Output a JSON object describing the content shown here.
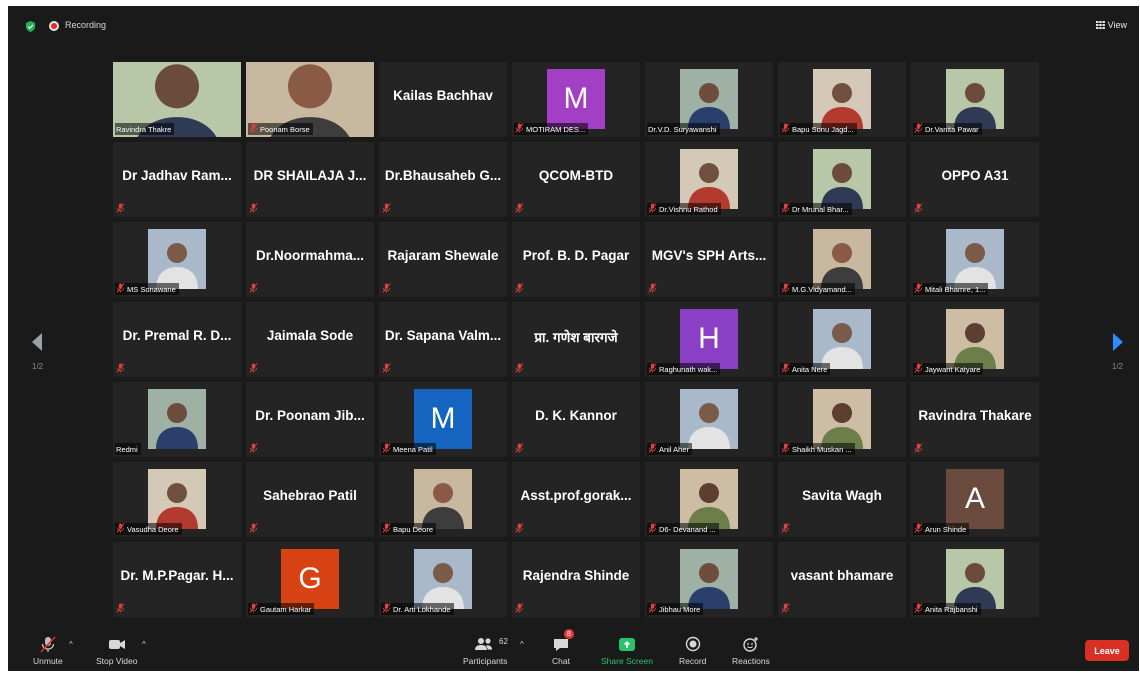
{
  "app": {
    "recording_label": "Recording",
    "view_label": "View"
  },
  "pager": {
    "left_page": "1/2",
    "right_page": "1/2"
  },
  "tiles": [
    {
      "label": "Ravindra Thakre",
      "kind": "video",
      "muted": false,
      "active": true
    },
    {
      "label": "Poonam Borse",
      "kind": "video",
      "muted": true
    },
    {
      "name": "Kailas Bachhav",
      "kind": "name",
      "muted": false
    },
    {
      "label": "MOTIRAM DES...",
      "kind": "avatar",
      "letter": "M",
      "color": "#a23fc4",
      "muted": true
    },
    {
      "label": "Dr.V.D. Suryawanshi",
      "kind": "photo",
      "muted": false
    },
    {
      "label": "Bapu Sonu Jagd...",
      "kind": "photo",
      "muted": true
    },
    {
      "label": "Dr.Vanita Pawar",
      "kind": "photo",
      "muted": true
    },
    {
      "name": "Dr Jadhav  Ram...",
      "kind": "name",
      "muted": true
    },
    {
      "name": "DR SHAILAJA J...",
      "kind": "name",
      "muted": true
    },
    {
      "name": "Dr.Bhausaheb  G...",
      "kind": "name",
      "muted": true
    },
    {
      "name": "QCOM-BTD",
      "kind": "name",
      "muted": true
    },
    {
      "label": "Dr.Vishnu Rathod",
      "kind": "photo",
      "muted": true
    },
    {
      "label": "Dr Mrunal Bhar...",
      "kind": "photo",
      "muted": true
    },
    {
      "name": "OPPO A31",
      "kind": "name",
      "muted": true
    },
    {
      "label": "MS Sonawane",
      "kind": "photo",
      "muted": true
    },
    {
      "name": "Dr.Noormahma...",
      "kind": "name",
      "muted": true
    },
    {
      "name": "Rajaram Shewale",
      "kind": "name",
      "muted": true
    },
    {
      "name": "Prof. B. D. Pagar",
      "kind": "name",
      "muted": true
    },
    {
      "name": "MGV's SPH Arts...",
      "kind": "name",
      "muted": true
    },
    {
      "label": "M.G.Vidyamand...",
      "kind": "photo",
      "muted": true
    },
    {
      "label": "Mitali Bhamre, 1...",
      "kind": "photo",
      "muted": true
    },
    {
      "name": "Dr. Premal R. D...",
      "kind": "name",
      "muted": true
    },
    {
      "name": "Jaimala Sode",
      "kind": "name",
      "muted": true
    },
    {
      "name": "Dr. Sapana Valm...",
      "kind": "name",
      "muted": true
    },
    {
      "name": "प्रा. गणेश बारगजे",
      "kind": "name",
      "muted": true
    },
    {
      "label": "Raghunath wak...",
      "kind": "avatar",
      "letter": "H",
      "color": "#8a3fc4",
      "muted": true
    },
    {
      "label": "Anita Nere",
      "kind": "photo",
      "muted": true
    },
    {
      "label": "Jaywant Katyare",
      "kind": "photo",
      "muted": true
    },
    {
      "label": "Redmi",
      "kind": "photo",
      "muted": false
    },
    {
      "name": "Dr. Poonam Jib...",
      "kind": "name",
      "muted": true
    },
    {
      "label": "Meena Patil",
      "kind": "avatar",
      "letter": "M",
      "color": "#1565c0",
      "muted": true
    },
    {
      "name": "D. K. Kannor",
      "kind": "name",
      "muted": true
    },
    {
      "label": "Anil Aher",
      "kind": "photo",
      "muted": true
    },
    {
      "label": "Shaikh Muskan ...",
      "kind": "photo",
      "muted": true
    },
    {
      "name": "Ravindra Thakare",
      "kind": "name",
      "muted": true
    },
    {
      "label": "Vasudha Deore",
      "kind": "photo",
      "muted": true
    },
    {
      "name": "Sahebrao Patil",
      "kind": "name",
      "muted": true
    },
    {
      "label": "Bapu Deore",
      "kind": "photo",
      "muted": true
    },
    {
      "name": "Asst.prof.gorak...",
      "kind": "name",
      "muted": true
    },
    {
      "label": "D6- Devanand ...",
      "kind": "photo",
      "muted": true
    },
    {
      "name": "Savita Wagh",
      "kind": "name",
      "muted": true
    },
    {
      "label": "Arun Shinde",
      "kind": "avatar",
      "letter": "A",
      "color": "#6b4a3e",
      "muted": true
    },
    {
      "name": "Dr. M.P.Pagar. H...",
      "kind": "name",
      "muted": true
    },
    {
      "label": "Gautam Harkar",
      "kind": "avatar",
      "letter": "G",
      "color": "#d84315",
      "muted": true
    },
    {
      "label": "Dr. Arti Lokhande",
      "kind": "photo",
      "muted": true
    },
    {
      "name": "Rajendra Shinde",
      "kind": "name",
      "muted": true
    },
    {
      "label": "Jibhau More",
      "kind": "photo",
      "muted": true
    },
    {
      "name": "vasant bhamare",
      "kind": "name",
      "muted": true
    },
    {
      "label": "Anita Rajbanshi",
      "kind": "photo",
      "muted": true
    }
  ],
  "toolbar": {
    "unmute": "Unmute",
    "stop_video": "Stop Video",
    "participants": "Participants",
    "participants_count": "62",
    "chat": "Chat",
    "chat_badge": "8",
    "share_screen": "Share Screen",
    "record": "Record",
    "reactions": "Reactions",
    "leave": "Leave"
  },
  "colors": {
    "background": "#1a1a1a",
    "tile": "#242424",
    "active_speaker": "#c9d43b",
    "share_green": "#27c36b",
    "leave_red": "#d93025"
  }
}
